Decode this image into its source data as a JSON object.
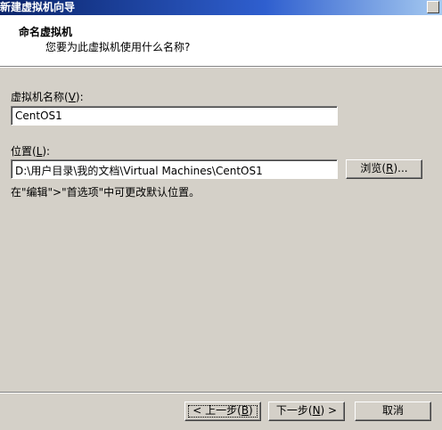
{
  "window": {
    "title": "新建虚拟机向导"
  },
  "header": {
    "title": "命名虚拟机",
    "subtitle": "您要为此虚拟机使用什么名称?"
  },
  "form": {
    "name_label_prefix": "虚拟机名称(",
    "name_label_key": "V",
    "name_label_suffix": "):",
    "name_value": "CentOS1",
    "location_label_prefix": "位置(",
    "location_label_key": "L",
    "location_label_suffix": "):",
    "location_value": "D:\\用户目录\\我的文档\\Virtual Machines\\CentOS1",
    "browse_prefix": "浏览(",
    "browse_key": "R",
    "browse_suffix": ")...",
    "hint": "在\"编辑\">\"首选项\"中可更改默认位置。"
  },
  "footer": {
    "back_prefix": "< 上一步(",
    "back_key": "B",
    "back_suffix": ")",
    "next_prefix": "下一步(",
    "next_key": "N",
    "next_suffix": ") >",
    "cancel_label": "取消"
  }
}
